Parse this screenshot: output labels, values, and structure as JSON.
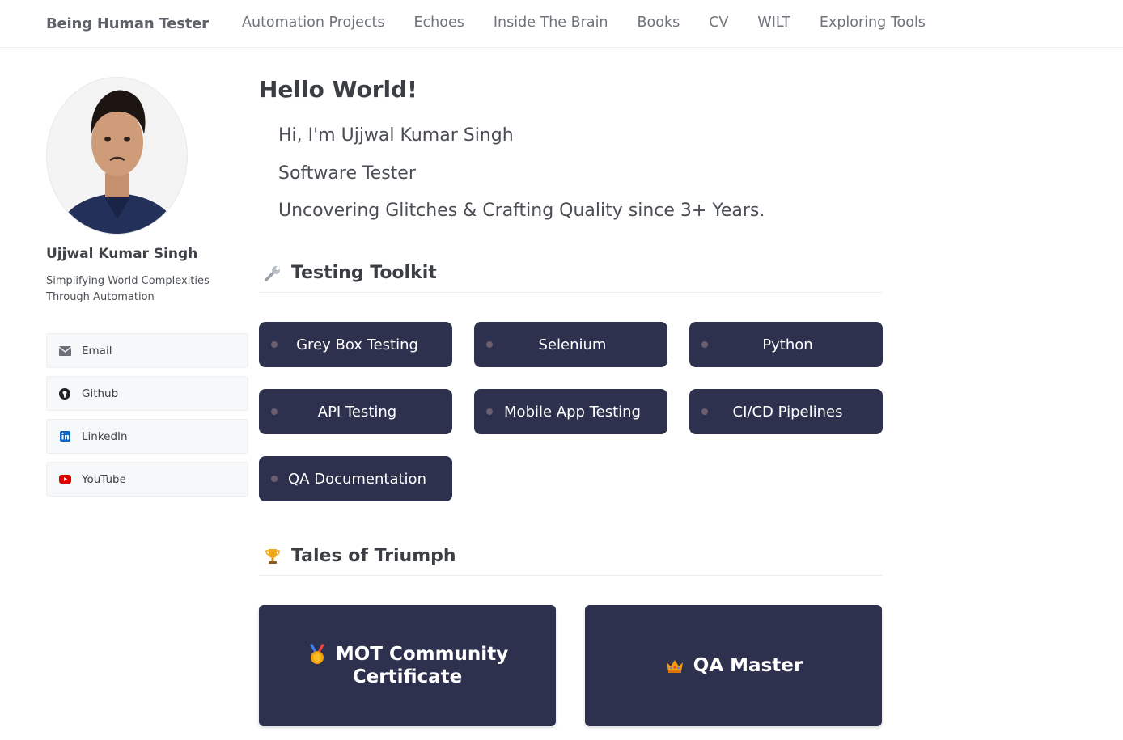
{
  "header": {
    "brand": "Being Human Tester",
    "nav": [
      "Automation Projects",
      "Echoes",
      "Inside The Brain",
      "Books",
      "CV",
      "WILT",
      "Exploring Tools"
    ]
  },
  "profile": {
    "name": "Ujjwal Kumar Singh",
    "bio": "Simplifying World Complexities Through Automation",
    "links": [
      {
        "label": "Email",
        "icon": "envelope-icon"
      },
      {
        "label": "Github",
        "icon": "github-icon"
      },
      {
        "label": "LinkedIn",
        "icon": "linkedin-icon"
      },
      {
        "label": "YouTube",
        "icon": "youtube-icon"
      }
    ]
  },
  "intro": {
    "heading": "Hello World!",
    "line1": "Hi, I'm Ujjwal Kumar Singh",
    "line2": "Software Tester",
    "line3": "Uncovering Glitches & Crafting Quality since 3+ Years."
  },
  "toolkit": {
    "title": "Testing Toolkit",
    "icon": "wrench-icon",
    "skills": [
      "Grey Box Testing",
      "Selenium",
      "Python",
      "API Testing",
      "Mobile App Testing",
      "CI/CD Pipelines",
      "QA Documentation"
    ]
  },
  "triumph": {
    "title": "Tales of Triumph",
    "icon": "trophy-icon",
    "cards": [
      {
        "line1": "MOT Community",
        "line2": "Certificate",
        "icon": "medal-icon"
      },
      {
        "line1": "QA Master",
        "line2": "",
        "icon": "crown-icon"
      }
    ]
  },
  "colors": {
    "card_bg": "#2e314e",
    "accent_text": "#ffffff",
    "text_dark": "#3b3f44"
  }
}
